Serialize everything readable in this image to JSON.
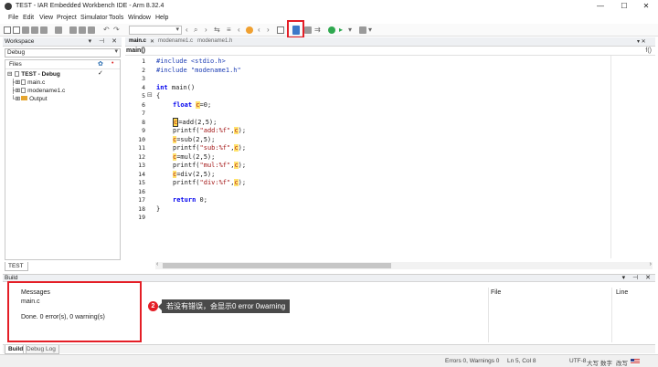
{
  "window": {
    "title": "TEST - IAR Embedded Workbench IDE - Arm 8.32.4",
    "min": "—",
    "max": "☐",
    "close": "✕"
  },
  "menu": [
    "File",
    "Edit",
    "View",
    "Project",
    "Simulator",
    "Tools",
    "Window",
    "Help"
  ],
  "toolbar": {
    "dropdown_value": ""
  },
  "callouts": [
    {
      "num": "1",
      "text": "编译"
    },
    {
      "num": "2",
      "text": "若没有错误，会显示0 error 0warning"
    }
  ],
  "workspace": {
    "title": "Workspace",
    "pane_buttons": "▾ ⊣ ✕",
    "config": "Debug",
    "files_header": "Files",
    "tree": [
      {
        "label": "TEST - Debug",
        "check": "✓"
      },
      {
        "label": "main.c"
      },
      {
        "label": "modename1.c"
      },
      {
        "label": "Output"
      }
    ],
    "tab": "TEST"
  },
  "editor": {
    "tabs": [
      {
        "label": "main.c",
        "close": "✕"
      },
      {
        "label": "modename1.c"
      },
      {
        "label": "modename1.h"
      }
    ],
    "function_scope": "main()",
    "fn_icon": "f()",
    "lines": [
      "1",
      "2",
      "3",
      "4",
      "5",
      "6",
      "7",
      "8",
      "9",
      "10",
      "11",
      "12",
      "13",
      "14",
      "15",
      "16",
      "17",
      "18",
      "19"
    ],
    "code": {
      "l1": "#include <stdio.h>",
      "l2": "#include \"modename1.h\"",
      "l4_kw": "int",
      "l4_rest": " main()",
      "l5": "{",
      "l7_kw": "float",
      "l7_var": "c",
      "l7_rest": "=0;",
      "l9_var": "c",
      "l9_rest": "=add(2,5);",
      "l10_a": "printf(",
      "l10_s": "\"add:%f\"",
      "l10_c": ",",
      "l10_var": "c",
      "l10_e": ");",
      "l11_var": "c",
      "l11_rest": "=sub(2,5);",
      "l12_s": "\"sub:%f\"",
      "l13_var": "c",
      "l13_rest": "=mul(2,5);",
      "l14_s": "\"mul:%f\"",
      "l15_var": "c",
      "l15_rest": "=div(2,5);",
      "l16_s": "\"div:%f\"",
      "l18_kw": "return",
      "l18_rest": " 0;",
      "l19": "}"
    }
  },
  "build": {
    "title": "Build",
    "pane_buttons": "▾ ⊣ ✕",
    "col_messages": "Messages",
    "col_file": "File",
    "col_line": "Line",
    "msg1": "main.c",
    "msg2": "Done. 0 error(s), 0 warning(s)",
    "tabs": [
      "Build",
      "Debug Log"
    ]
  },
  "status": {
    "errors": "Errors 0, Warnings 0",
    "position": "Ln 5, Col 8",
    "encoding": "UTF-8",
    "caps": "大写",
    "num": "数字",
    "ovr": "改写"
  }
}
